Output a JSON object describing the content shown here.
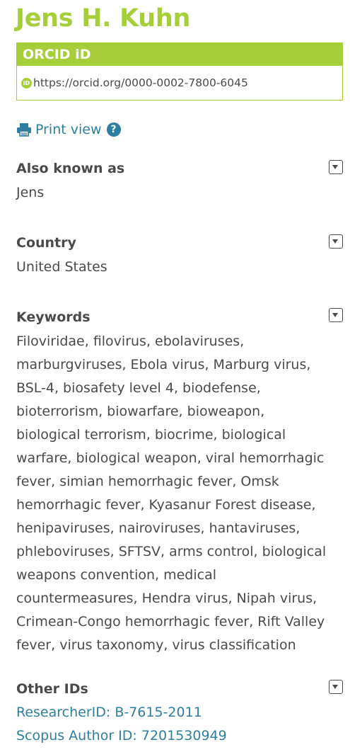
{
  "person": {
    "name": "Jens H. Kuhn"
  },
  "orcid": {
    "header": "ORCID iD",
    "badge": "iD",
    "url": "https://orcid.org/0000-0002-7800-6045"
  },
  "print_view": {
    "label": "Print view",
    "help": "?"
  },
  "sections": {
    "also_known_as": {
      "title": "Also known as",
      "value": "Jens"
    },
    "country": {
      "title": "Country",
      "value": "United States"
    },
    "keywords": {
      "title": "Keywords",
      "lines": [
        "Filoviridae, filovirus, ebolaviruses,",
        "marburgviruses, Ebola virus, Marburg virus,",
        "BSL-4, biosafety level 4, biodefense,",
        "bioterrorism, biowarfare, bioweapon,",
        "biological terrorism, biocrime, biological",
        "warfare, biological weapon, viral hemorrhagic",
        "fever, simian hemorrhagic fever, Omsk",
        "hemorrhagic fever, Kyasanur Forest disease,",
        "henipaviruses, nairoviruses, hantaviruses,",
        "phleboviruses, SFTSV, arms control, biological",
        "weapons convention, medical",
        "countermeasures, Hendra virus, Nipah virus,",
        "Crimean-Congo hemorrhagic fever, Rift Valley",
        "fever, virus taxonomy, virus classification"
      ]
    },
    "other_ids": {
      "title": "Other IDs",
      "links": [
        "ResearcherID: B-7615-2011",
        "Scopus Author ID: 7201530949"
      ]
    }
  },
  "colors": {
    "brand_green": "#a6ce39",
    "link_blue": "#2e7f9f",
    "text": "#494a4c"
  },
  "icons": {
    "print": "printer-icon",
    "help": "question-circle-icon",
    "toggle": "caret-down-icon",
    "orcid": "orcid-id-icon"
  }
}
